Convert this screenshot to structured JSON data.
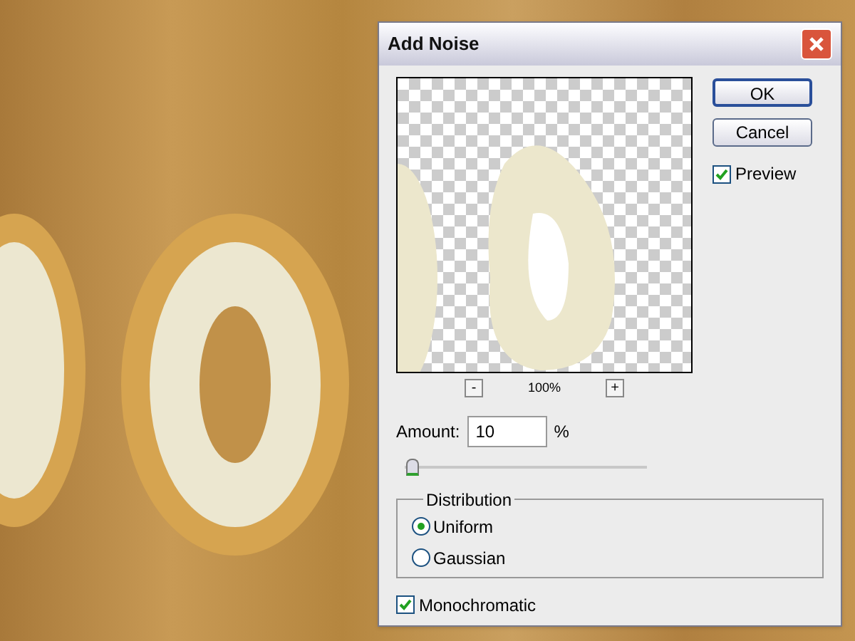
{
  "dialog": {
    "title": "Add Noise",
    "buttons": [
      {
        "label": "OK",
        "kind": "default"
      },
      {
        "label": "Cancel",
        "kind": "normal"
      }
    ],
    "preview": {
      "label": "Preview",
      "checked": true
    },
    "zoom": {
      "minus": "-",
      "reading": "100%",
      "plus": "+"
    },
    "amount": {
      "label": "Amount:",
      "value": "10",
      "unit": "%",
      "level": 0.03
    },
    "distribution": {
      "title": "Distribution",
      "options": [
        {
          "label": "Uniform",
          "selected": true
        },
        {
          "label": "Gaussian",
          "selected": false
        }
      ]
    },
    "monochromatic": {
      "label": "Monochromatic",
      "checked": true
    }
  }
}
